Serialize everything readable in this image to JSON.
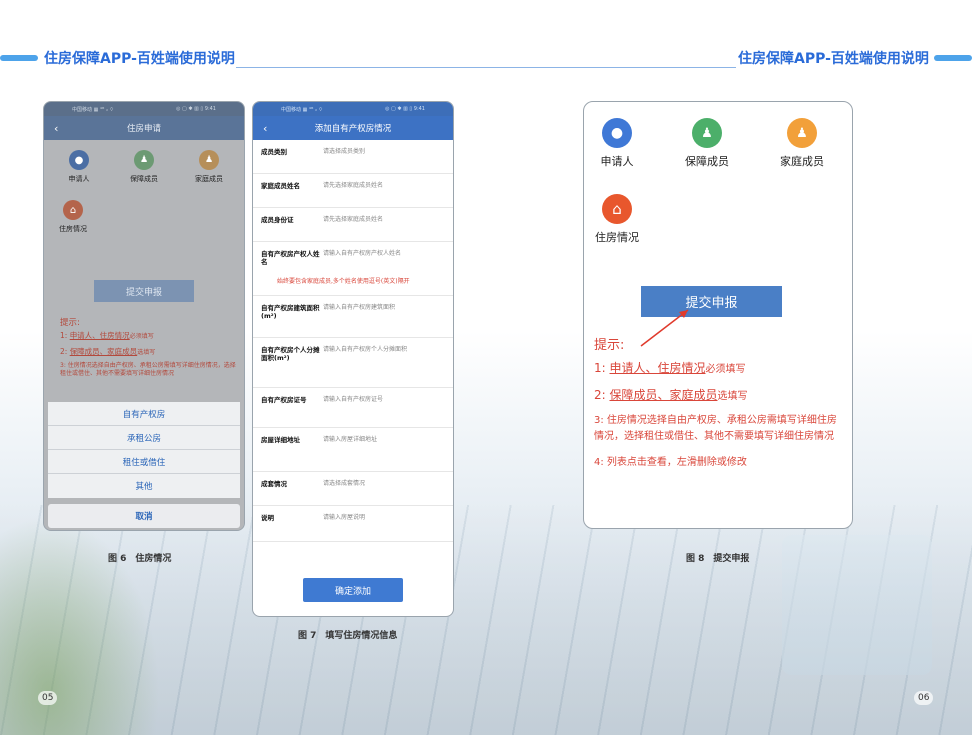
{
  "header": {
    "left_title": "住房保障APP-百姓端使用说明",
    "right_title": "住房保障APP-百姓端使用说明"
  },
  "page_numbers": {
    "left": "05",
    "right": "06"
  },
  "captions": {
    "fig6": "图 6　住房情况",
    "fig7": "图 7　填写住房情况信息",
    "fig8": "图 8　提交申报"
  },
  "colors": {
    "brand_blue": "#2a6bd8",
    "title_bar": "#3d72c4",
    "tip_red": "#c8362a",
    "applicant_icon": "#3f78d6",
    "member_icon": "#4caf6a",
    "family_icon": "#f2a03a",
    "housing_icon": "#e8572d"
  },
  "phone1": {
    "status_left": "中国移动 ▦ ⁴ᴳ ᵢₗ ⌔",
    "status_right": "◎ ▢ ✱ ▥ ▯ 9:41",
    "back": "‹",
    "title": "住房申请",
    "icons": [
      {
        "label": "申请人",
        "icon": "user-icon"
      },
      {
        "label": "保障成员",
        "icon": "members-icon"
      },
      {
        "label": "家庭成员",
        "icon": "family-icon"
      }
    ],
    "housing": {
      "label": "住房情况",
      "icon": "house-icon"
    },
    "submit_label": "提交申报",
    "tips": {
      "title": "提示:",
      "line1_prefix": "1: ",
      "line1_link": "申请人、住房情况",
      "line1_suffix": "必须填写",
      "line2_prefix": "2: ",
      "line2_link": "保障成员、家庭成员",
      "line2_suffix": "选填写",
      "line3": "3: 住房情况选择自由产权房、承租公房需填写详细住房情况，选择租住或借住、其他不需要填写详细住房情况"
    },
    "sheet_options": [
      "自有产权房",
      "承租公房",
      "租住或借住",
      "其他"
    ],
    "cancel_label": "取消"
  },
  "phone2": {
    "status_left": "中国移动 ▦ ⁴ᴳ ᵢₗ ⌔",
    "status_right": "◎ ▢ ✱ ▥ ▯ 9:41",
    "back": "‹",
    "title": "添加自有产权房情况",
    "fields": [
      {
        "label": "成员类别",
        "placeholder": "请选择成员类别"
      },
      {
        "label": "家庭成员姓名",
        "placeholder": "请先选择家庭成员姓名"
      },
      {
        "label": "成员身份证",
        "placeholder": "请先选择家庭成员姓名"
      },
      {
        "label": "自有产权房产权人姓名",
        "placeholder": "请输入自有产权房产权人姓名"
      },
      {
        "label": "自有产权房建筑面积(m²)",
        "placeholder": "请输入自有产权房建筑面积"
      },
      {
        "label": "自有产权房个人分摊面积(m²)",
        "placeholder": "请输入自有产权房个人分摊面积"
      },
      {
        "label": "自有产权房证号",
        "placeholder": "请输入自有产权房证号"
      },
      {
        "label": "房屋详细地址",
        "placeholder": "请输入房屋详细地址"
      },
      {
        "label": "成套情况",
        "placeholder": "请选择成套情况"
      },
      {
        "label": "说明",
        "placeholder": "请输入房屋说明"
      }
    ],
    "warning": "始终要包含家庭成员,多个姓名使用逗号(英文)隔开",
    "confirm_label": "确定添加"
  },
  "phone3": {
    "icons": [
      {
        "label": "申请人",
        "icon": "user-icon"
      },
      {
        "label": "保障成员",
        "icon": "members-icon"
      },
      {
        "label": "家庭成员",
        "icon": "family-icon"
      }
    ],
    "housing": {
      "label": "住房情况",
      "icon": "house-icon"
    },
    "submit_label": "提交申报",
    "tips": {
      "title": "提示:",
      "line1_prefix": "1: ",
      "line1_link": "申请人、住房情况",
      "line1_suffix": "必须填写",
      "line2_prefix": "2: ",
      "line2_link": "保障成员、家庭成员",
      "line2_suffix": "选填写",
      "line3": "3: 住房情况选择自由产权房、承租公房需填写详细住房情况，选择租住或借住、其他不需要填写详细住房情况",
      "line4": "4: 列表点击查看，左滑删除或修改"
    }
  }
}
